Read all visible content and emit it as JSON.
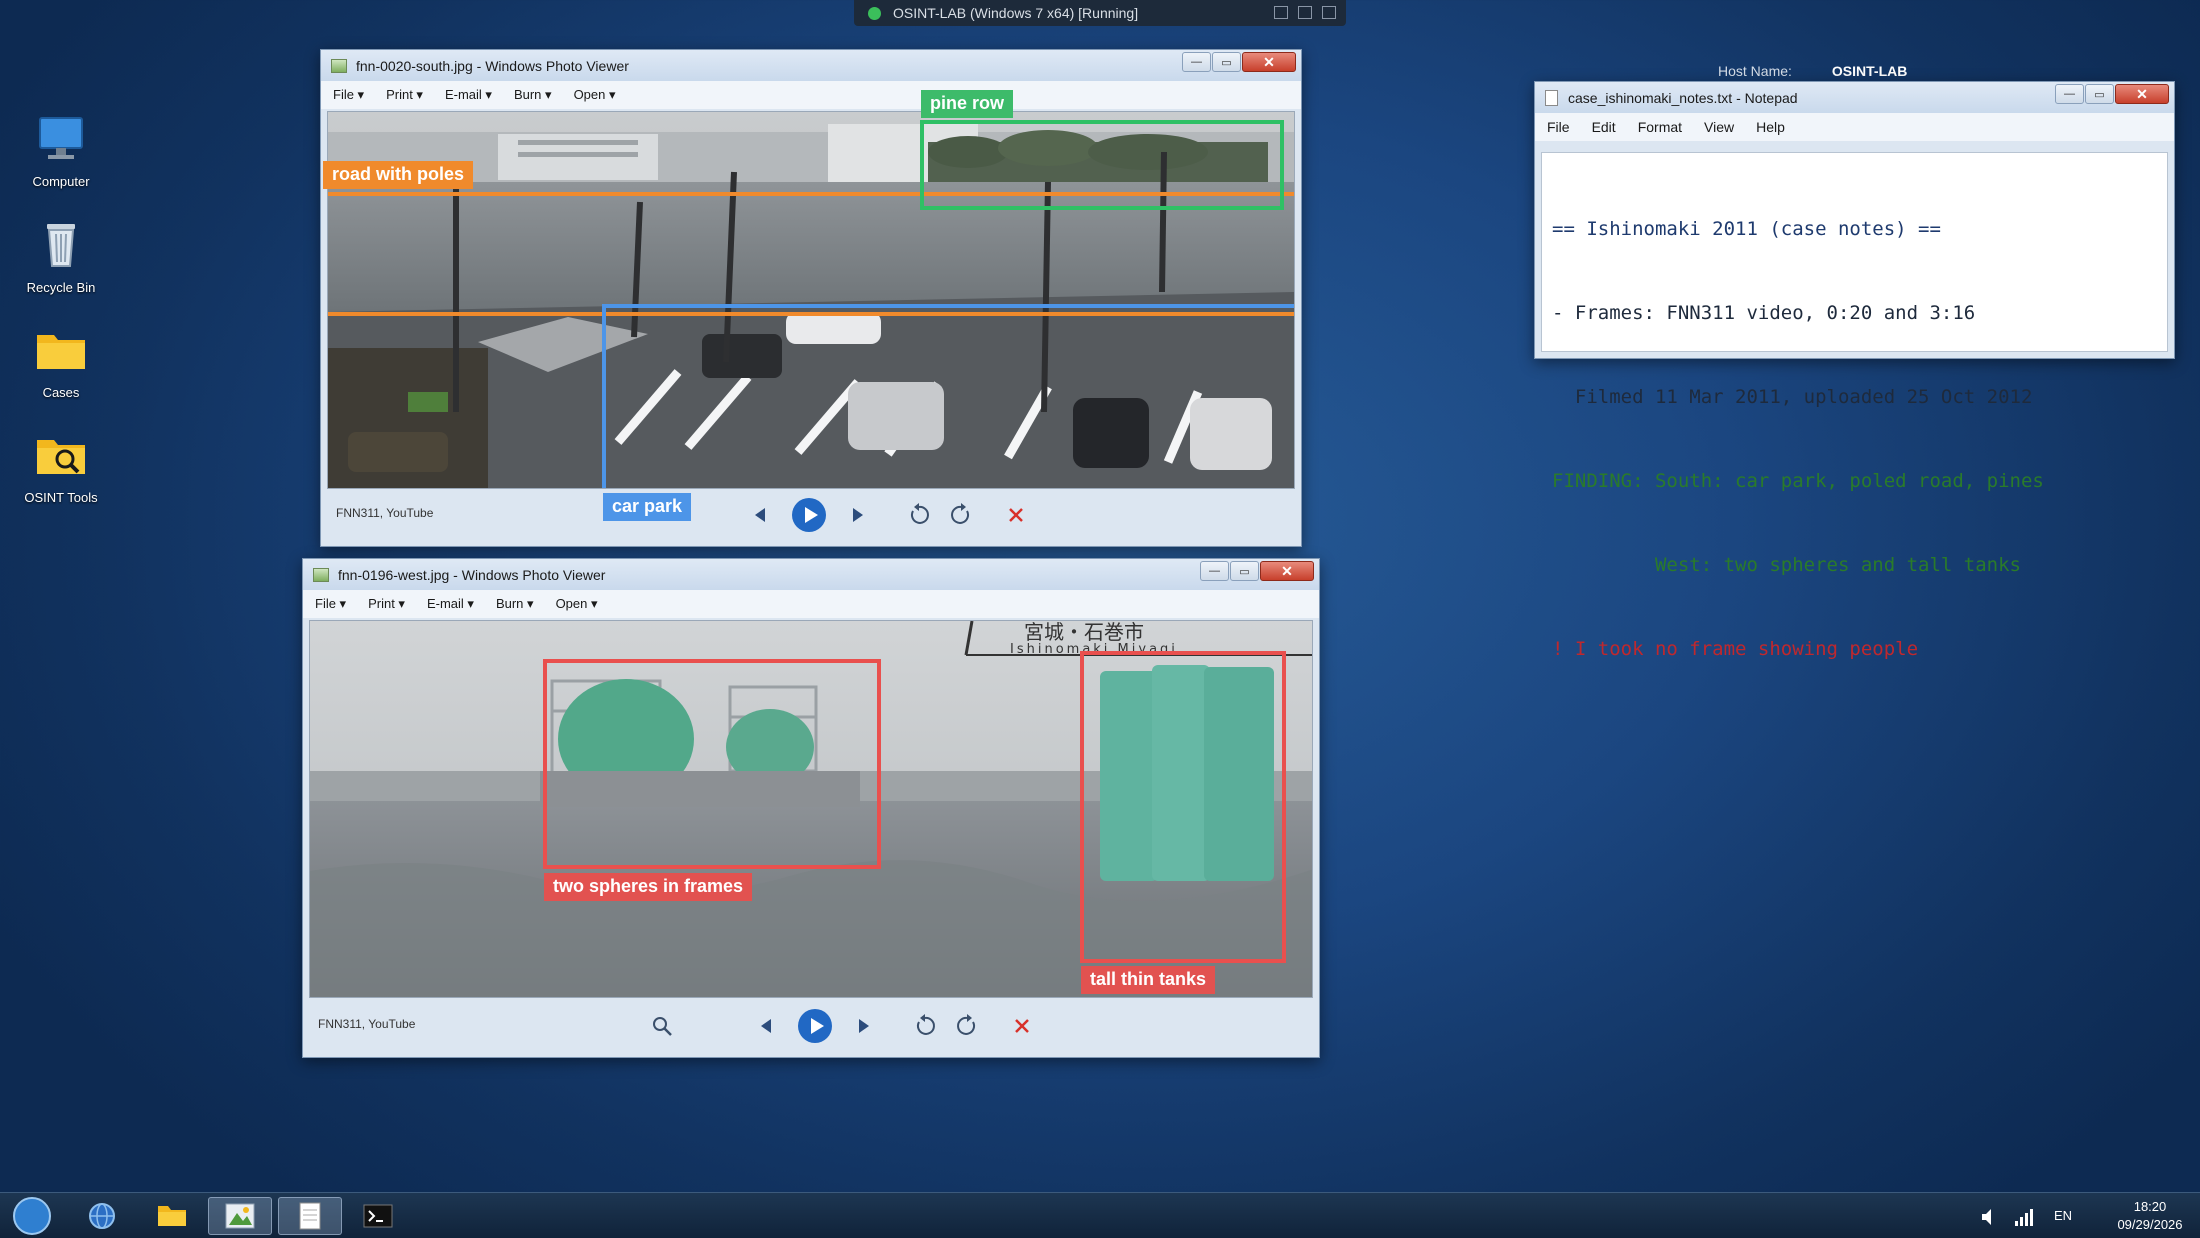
{
  "vm": {
    "title": "OSINT-LAB (Windows 7 x64) [Running]"
  },
  "desktop": {
    "icons": [
      {
        "label": "Computer"
      },
      {
        "label": "Recycle Bin"
      },
      {
        "label": "Cases"
      },
      {
        "label": "OSINT Tools"
      }
    ],
    "host": {
      "label": "Host Name:",
      "value": "OSINT-LAB"
    }
  },
  "viewer_south": {
    "title": "fnn-0020-south.jpg - Windows Photo Viewer",
    "menu": [
      "File ▾",
      "Print ▾",
      "E-mail ▾",
      "Burn ▾",
      "Open ▾"
    ],
    "credit": "FNN311, YouTube",
    "annotations": {
      "road": "road with poles",
      "pines": "pine row",
      "carpark": "car park"
    }
  },
  "viewer_west": {
    "title": "fnn-0196-west.jpg - Windows Photo Viewer",
    "menu": [
      "File ▾",
      "Print ▾",
      "E-mail ▾",
      "Burn ▾",
      "Open ▾"
    ],
    "credit": "FNN311, YouTube",
    "sign": {
      "kanji": "宮城・石巻市",
      "romaji": "Ishinomaki Miyagi"
    },
    "annotations": {
      "spheres": "two spheres in frames",
      "tanks": "tall thin tanks"
    }
  },
  "notepad": {
    "title": "case_ishinomaki_notes.txt - Notepad",
    "menu": [
      "File",
      "Edit",
      "Format",
      "View",
      "Help"
    ],
    "lines": [
      "== Ishinomaki 2011 (case notes) ==",
      "- Frames: FNN311 video, 0:20 and 3:16",
      "  Filmed 11 Mar 2011, uploaded 25 Oct 2012",
      "FINDING: South: car park, poled road, pines",
      "         West: two spheres and tall tanks",
      "! I took no frame showing people"
    ]
  },
  "taskbar": {
    "lang": "EN",
    "time": "18:20",
    "date": "09/29/2026"
  },
  "colors": {
    "orange": "#f08a2c",
    "green": "#3dbb6a",
    "blue": "#4d95e8",
    "red": "#e25250"
  }
}
